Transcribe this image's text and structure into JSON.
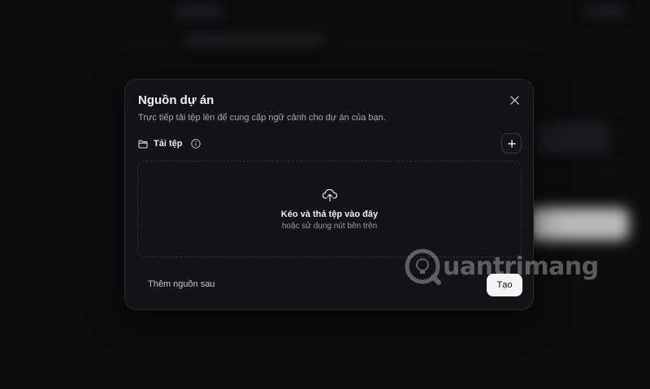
{
  "modal": {
    "title": "Nguồn dự án",
    "description": "Trực tiếp tải tệp lên để cung cấp ngữ cảnh cho dự án của bạn.",
    "section_label": "Tải tệp",
    "dropzone": {
      "title": "Kéo và thả tệp vào đây",
      "subtitle": "hoặc sử dụng nút bên trên"
    },
    "later_button": "Thêm nguồn sau",
    "create_button": "Tạo"
  },
  "watermark": {
    "text": "uantrimang"
  },
  "colors": {
    "background": "#0c0c0d",
    "modal_bg": "#131315",
    "accent_button": "#f5f5f5"
  },
  "icons": {
    "close": "close-icon",
    "folder": "folder-icon",
    "info": "info-icon",
    "plus": "plus-icon",
    "upload": "cloud-upload-icon"
  }
}
